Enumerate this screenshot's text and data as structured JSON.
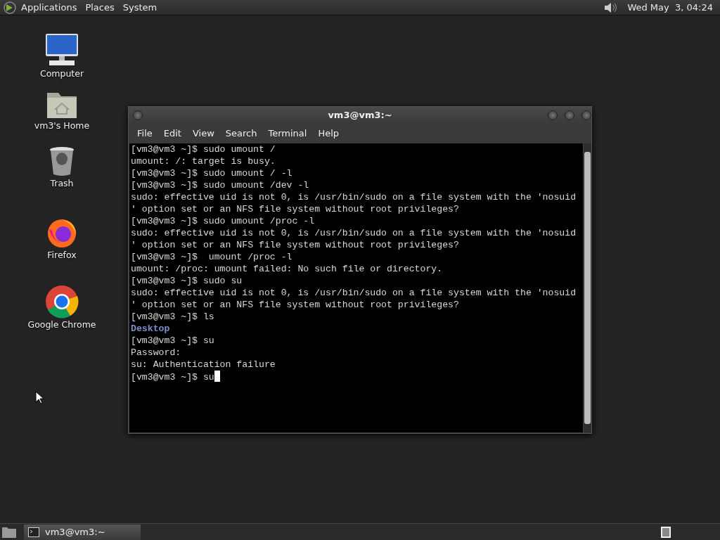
{
  "top_panel": {
    "menus": [
      "Applications",
      "Places",
      "System"
    ],
    "clock": "Wed May  3, 04:24"
  },
  "desktop_icons": [
    {
      "label": "Computer",
      "kind": "computer"
    },
    {
      "label": "vm3's Home",
      "kind": "home"
    },
    {
      "label": "Trash",
      "kind": "trash"
    },
    {
      "label": "Firefox",
      "kind": "firefox"
    },
    {
      "label": "Google Chrome",
      "kind": "chrome"
    }
  ],
  "window": {
    "title": "vm3@vm3:~",
    "menu": [
      "File",
      "Edit",
      "View",
      "Search",
      "Terminal",
      "Help"
    ],
    "lines": [
      {
        "text": "[vm3@vm3 ~]$ sudo umount /",
        "kind": "normal"
      },
      {
        "text": "umount: /: target is busy.",
        "kind": "normal"
      },
      {
        "text": "[vm3@vm3 ~]$ sudo umount / -l",
        "kind": "normal"
      },
      {
        "text": "[vm3@vm3 ~]$ sudo umount /dev -l",
        "kind": "normal"
      },
      {
        "text": "sudo: effective uid is not 0, is /usr/bin/sudo on a file system with the 'nosuid",
        "kind": "normal"
      },
      {
        "text": "' option set or an NFS file system without root privileges?",
        "kind": "normal"
      },
      {
        "text": "[vm3@vm3 ~]$ sudo umount /proc -l",
        "kind": "normal"
      },
      {
        "text": "sudo: effective uid is not 0, is /usr/bin/sudo on a file system with the 'nosuid",
        "kind": "normal"
      },
      {
        "text": "' option set or an NFS file system without root privileges?",
        "kind": "normal"
      },
      {
        "text": "[vm3@vm3 ~]$  umount /proc -l",
        "kind": "normal"
      },
      {
        "text": "umount: /proc: umount failed: No such file or directory.",
        "kind": "normal"
      },
      {
        "text": "[vm3@vm3 ~]$ sudo su",
        "kind": "normal"
      },
      {
        "text": "sudo: effective uid is not 0, is /usr/bin/sudo on a file system with the 'nosuid",
        "kind": "normal"
      },
      {
        "text": "' option set or an NFS file system without root privileges?",
        "kind": "normal"
      },
      {
        "text": "[vm3@vm3 ~]$ ls",
        "kind": "normal"
      },
      {
        "text": "Desktop",
        "kind": "directory"
      },
      {
        "text": "[vm3@vm3 ~]$ su",
        "kind": "normal"
      },
      {
        "text": "Password:",
        "kind": "normal"
      },
      {
        "text": "su: Authentication failure",
        "kind": "normal"
      },
      {
        "text": "[vm3@vm3 ~]$ su",
        "kind": "cursor"
      }
    ]
  },
  "taskbar": {
    "tasks": [
      {
        "label": "vm3@vm3:~",
        "selected": true
      }
    ]
  }
}
